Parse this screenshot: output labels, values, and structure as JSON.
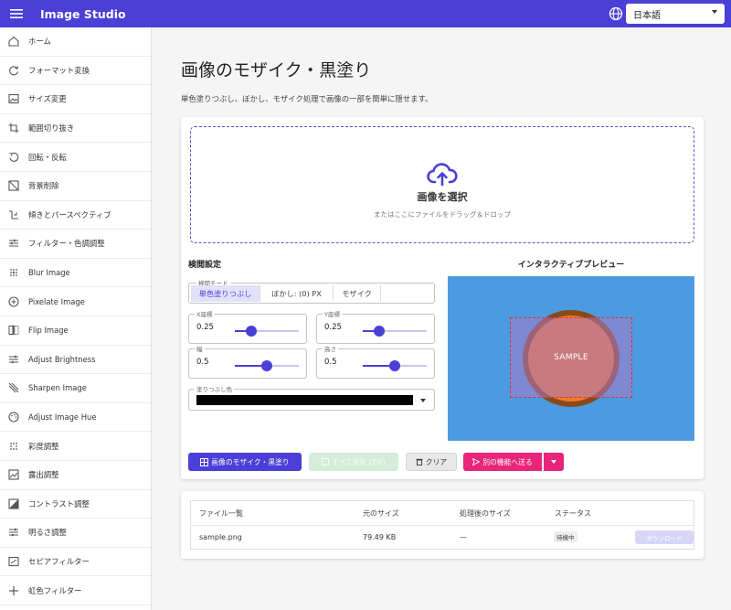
{
  "app": {
    "title": "Image Studio",
    "language": "日本語",
    "accent": "#4a3fd6"
  },
  "sidebar": {
    "items": [
      {
        "label": "ホーム",
        "icon": "home-icon"
      },
      {
        "label": "フォーマット変換",
        "icon": "refresh-icon"
      },
      {
        "label": "サイズ変更",
        "icon": "image-icon"
      },
      {
        "label": "範囲切り抜き",
        "icon": "crop-icon"
      },
      {
        "label": "回転・反転",
        "icon": "rotate-icon"
      },
      {
        "label": "背景削除",
        "icon": "background-remove-icon"
      },
      {
        "label": "傾きとパースペクティブ",
        "icon": "perspective-icon"
      },
      {
        "label": "フィルター・色調調整",
        "icon": "tune-icon"
      },
      {
        "label": "Blur Image",
        "icon": "blur-icon"
      },
      {
        "label": "Pixelate Image",
        "icon": "pixelate-icon"
      },
      {
        "label": "Flip Image",
        "icon": "flip-icon"
      },
      {
        "label": "Adjust Brightness",
        "icon": "brightness-icon"
      },
      {
        "label": "Sharpen Image",
        "icon": "sharpen-icon"
      },
      {
        "label": "Adjust Image Hue",
        "icon": "palette-icon"
      },
      {
        "label": "彩度調整",
        "icon": "saturation-icon"
      },
      {
        "label": "露出調整",
        "icon": "exposure-icon"
      },
      {
        "label": "コントラスト調整",
        "icon": "contrast-icon"
      },
      {
        "label": "明るさ調整",
        "icon": "brightness-icon"
      },
      {
        "label": "セピアフィルター",
        "icon": "sepia-icon"
      },
      {
        "label": "虹色フィルター",
        "icon": "plus-icon"
      }
    ]
  },
  "page": {
    "title": "画像のモザイク・黒塗り",
    "description": "単色塗りつぶし、ぼかし、モザイク処理で画像の一部を簡単に隠せます。"
  },
  "dropzone": {
    "title": "画像を選択",
    "subtitle": "またはここにファイルをドラッグ＆ドロップ"
  },
  "settings": {
    "title": "検閲設定",
    "mode_label": "検閲モード",
    "modes": [
      "単色塗りつぶし",
      "ぼかし: (0) PX",
      "モザイク"
    ],
    "active_mode": 0,
    "sliders": [
      {
        "label": "X座標",
        "value": "0.25",
        "fraction": 0.25
      },
      {
        "label": "Y座標",
        "value": "0.25",
        "fraction": 0.25
      },
      {
        "label": "幅",
        "value": "0.5",
        "fraction": 0.5
      },
      {
        "label": "高さ",
        "value": "0.5",
        "fraction": 0.5
      }
    ],
    "fill_color_label": "塗りつぶし色",
    "fill_color": "#000000"
  },
  "preview": {
    "title": "インタラクティブプレビュー",
    "sample_text": "SAMPLE",
    "background_color": "#4c9be0",
    "circle_color": "#f07c24"
  },
  "actions": {
    "apply": "画像のモザイク・黒塗り",
    "save_all": "すべて保存 (ZIP)",
    "clear": "クリア",
    "send": "別の機能へ送る"
  },
  "files": {
    "headers": [
      "ファイル一覧",
      "元のサイズ",
      "処理後のサイズ",
      "ステータス"
    ],
    "rows": [
      {
        "name": "sample.png",
        "original_size": "79.49 KB",
        "processed_size": "—",
        "status": "待機中",
        "download": "ダウンロード"
      }
    ]
  }
}
